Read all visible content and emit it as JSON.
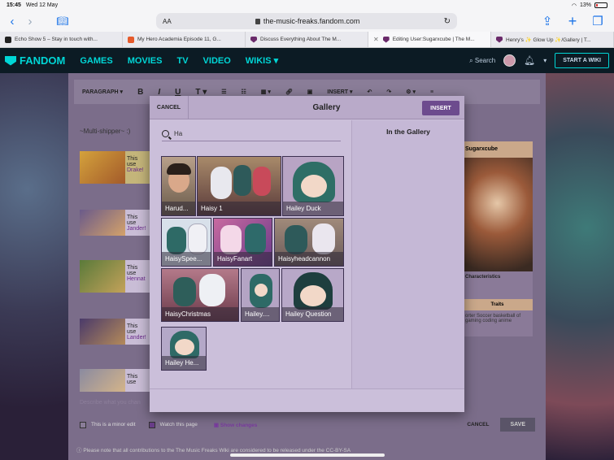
{
  "status_bar": {
    "time": "15:45",
    "date": "Wed 12 May",
    "battery": "13%"
  },
  "browser": {
    "text_size_label": "AA",
    "url": "the-music-freaks.fandom.com",
    "tabs": [
      {
        "title": "Echo Show 5 – Stay in touch with...",
        "color": "#ff9900"
      },
      {
        "title": "My Hero Academia Episode 11, G...",
        "color": "#e55a2b"
      },
      {
        "title": "Discuss Everything About The M...",
        "color": "#6a2a6a"
      },
      {
        "title": "Editing User:Sugarxcube | The M...",
        "color": "#6a2a6a",
        "active": true
      },
      {
        "title": "Henry's ✨ Glow Up ✨/Gallery | T...",
        "color": "#6a2a6a"
      }
    ]
  },
  "fandom_nav": {
    "logo": "FANDOM",
    "links": [
      "GAMES",
      "MOVIES",
      "TV",
      "VIDEO",
      "WIKIS"
    ],
    "search_label": "Search",
    "start_wiki": "START A WIKI"
  },
  "editor": {
    "toolbar": {
      "paragraph": "PARAGRAPH",
      "insert": "INSERT"
    },
    "body_text": "~Multi-shipper~ :)",
    "rows": [
      {
        "line1": "This use",
        "line2": "Drake!"
      },
      {
        "line1": "This use",
        "line2": "Jander!"
      },
      {
        "line1": "This use",
        "line2": "Hennat"
      },
      {
        "line1": "This use",
        "line2": "Lander!"
      },
      {
        "line1": "This use",
        "line2": ""
      }
    ],
    "sidebar": {
      "header": "Sugarxcube",
      "characteristics": "Characteristics",
      "traits": "Traits",
      "traits_text": "orter Soccer basketball of gaming coding anime"
    },
    "summary_placeholder": "Describe what you chan",
    "minor_edit": "This is a minor edit",
    "watch_page": "Watch this page",
    "show_changes": "Show changes",
    "cancel": "CANCEL",
    "save": "SAVE",
    "legal": "Please note that all contributions to the The Music Freaks Wiki are considered to be released under the CC-BY-SA"
  },
  "gallery_modal": {
    "title": "Gallery",
    "cancel": "CANCEL",
    "insert": "INSERT",
    "search_value": "Ha",
    "in_gallery_title": "In the Gallery",
    "tiles": [
      {
        "caption": "Harud..."
      },
      {
        "caption": "Haisy 1"
      },
      {
        "caption": "Hailey Duck"
      },
      {
        "caption": "HaisySpee..."
      },
      {
        "caption": "HaisyFanart"
      },
      {
        "caption": "Haisyheadcannon"
      },
      {
        "caption": "HaisyChristmas"
      },
      {
        "caption": "Hailey...."
      },
      {
        "caption": "Hailey Question"
      },
      {
        "caption": "Hailey He..."
      }
    ]
  }
}
